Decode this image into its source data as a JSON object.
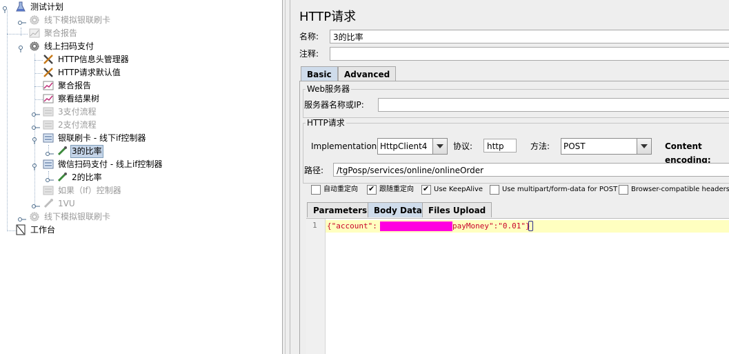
{
  "tree": {
    "root": "测试计划",
    "items": [
      {
        "label": "线下模拟银联刷卡",
        "disabled": true
      },
      {
        "label": "聚合报告",
        "disabled": true
      },
      {
        "label": "线上扫码支付",
        "disabled": false
      },
      {
        "label": "HTTP信息头管理器",
        "disabled": false
      },
      {
        "label": "HTTP请求默认值",
        "disabled": false
      },
      {
        "label": "聚合报告",
        "disabled": false
      },
      {
        "label": "察看结果树",
        "disabled": false
      },
      {
        "label": "3支付流程",
        "disabled": true
      },
      {
        "label": "2支付流程",
        "disabled": true
      },
      {
        "label": "银联刷卡 - 线下if控制器",
        "disabled": false
      },
      {
        "label": "3的比率",
        "disabled": false,
        "selected": true
      },
      {
        "label": "微信扫码支付 - 线上if控制器",
        "disabled": false
      },
      {
        "label": "2的比率",
        "disabled": false
      },
      {
        "label": "如果（If）控制器",
        "disabled": true
      },
      {
        "label": "1VU",
        "disabled": true
      },
      {
        "label": "线下模拟银联刷卡",
        "disabled": true
      }
    ],
    "workbench": "工作台"
  },
  "panel": {
    "title": "HTTP请求",
    "name_label": "名称:",
    "name_value": "3的比率",
    "comment_label": "注释:",
    "comment_value": "",
    "tabs": [
      "Basic",
      "Advanced"
    ],
    "active_tab": "Basic",
    "web_server": {
      "group_label": "Web服务器",
      "server_label": "服务器名称或IP:",
      "server_value": ""
    },
    "http_request": {
      "group_label": "HTTP请求",
      "implementation_label": "Implementation:",
      "implementation_value": "HttpClient4",
      "protocol_label": "协议:",
      "protocol_value": "http",
      "method_label": "方法:",
      "method_value": "POST",
      "content_encoding_label": "Content encoding:",
      "path_label": "路径:",
      "path_value": "/tgPosp/services/online/onlineOrder"
    },
    "checkboxes": [
      {
        "label": "自动重定向",
        "checked": false
      },
      {
        "label": "跟随重定向",
        "checked": true
      },
      {
        "label": "Use KeepAlive",
        "checked": true
      },
      {
        "label": "Use multipart/form-data for POST",
        "checked": false
      },
      {
        "label": "Browser-compatible headers",
        "checked": false
      }
    ],
    "subtabs": [
      "Parameters",
      "Body Data",
      "Files Upload"
    ],
    "active_subtab": "Body Data",
    "body": {
      "line_number": "1",
      "code_start": "{\"account\":",
      "code_end": "payMoney\":\"0.01\"}",
      "redaction_color": "#ff00e0"
    }
  }
}
